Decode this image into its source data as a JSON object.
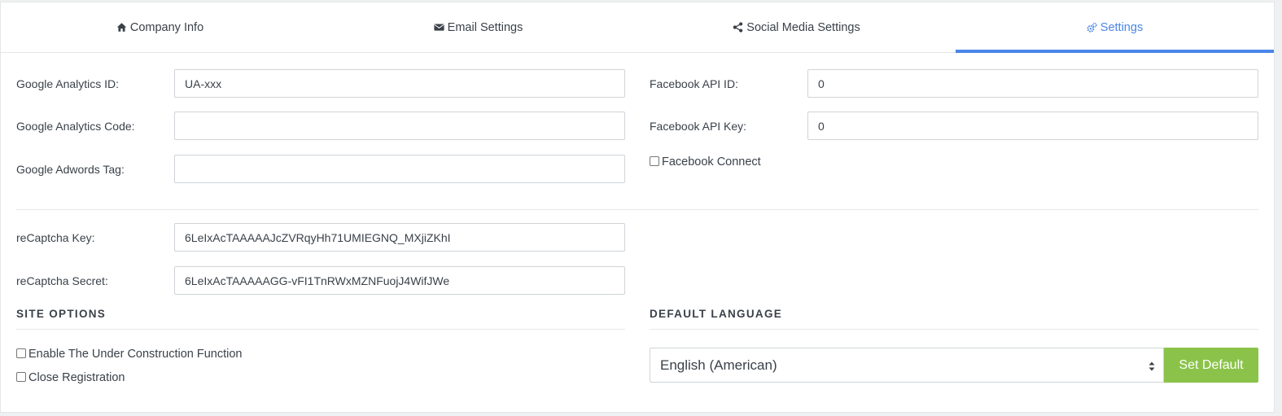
{
  "tabs": [
    {
      "label": "Company Info",
      "icon": "home-icon"
    },
    {
      "label": "Email Settings",
      "icon": "envelope-icon"
    },
    {
      "label": "Social Media Settings",
      "icon": "share-icon"
    },
    {
      "label": "Settings",
      "icon": "cogs-icon",
      "active": true
    }
  ],
  "colors": {
    "accent": "#4a86e8",
    "button": "#8bc34a"
  },
  "analytics": {
    "ga_id_label": "Google Analytics ID:",
    "ga_id_value": "UA-xxx",
    "ga_code_label": "Google Analytics Code:",
    "ga_code_value": "",
    "adwords_label": "Google Adwords Tag:",
    "adwords_value": ""
  },
  "facebook": {
    "api_id_label": "Facebook API ID:",
    "api_id_value": "0",
    "api_key_label": "Facebook API Key:",
    "api_key_value": "0",
    "connect_label": "Facebook Connect",
    "connect_checked": false
  },
  "recaptcha": {
    "key_label": "reCaptcha Key:",
    "key_value": "6LeIxAcTAAAAAJcZVRqyHh71UMIEGNQ_MXjiZKhI",
    "secret_label": "reCaptcha Secret:",
    "secret_value": "6LeIxAcTAAAAAGG-vFI1TnRWxMZNFuojJ4WifJWe"
  },
  "site_options": {
    "title": "SITE OPTIONS",
    "under_construction_label": "Enable The Under Construction Function",
    "close_registration_label": "Close Registration"
  },
  "language": {
    "title": "DEFAULT LANGUAGE",
    "selected": "English (American)",
    "set_default_label": "Set Default"
  }
}
